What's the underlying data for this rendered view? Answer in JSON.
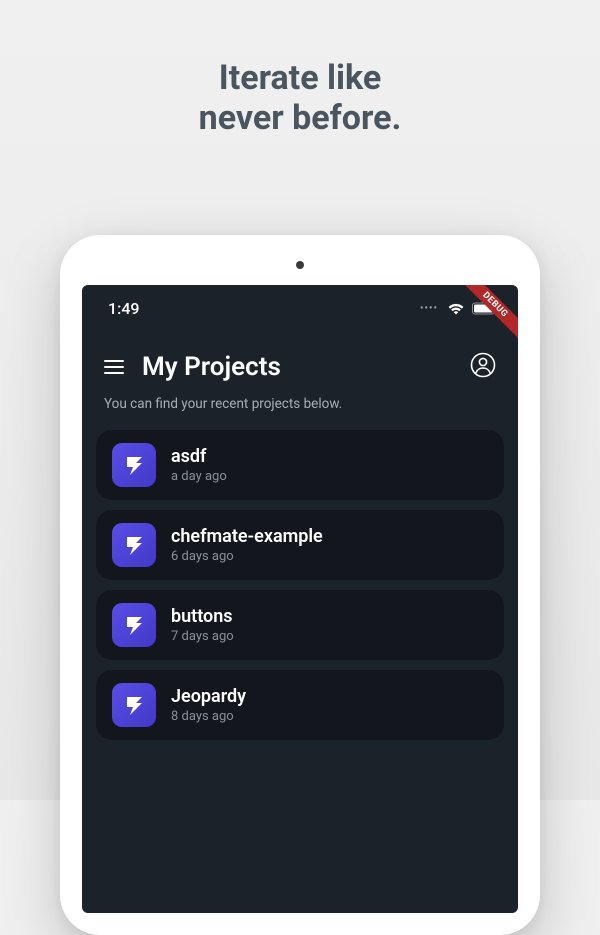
{
  "headline": {
    "line1": "Iterate like",
    "line2": "never before."
  },
  "debugBanner": "DEBUG",
  "statusBar": {
    "time": "1:49"
  },
  "header": {
    "title": "My Projects"
  },
  "subheading": "You can find your recent projects below.",
  "projects": [
    {
      "name": "asdf",
      "time": "a day ago"
    },
    {
      "name": "chefmate-example",
      "time": "6 days ago"
    },
    {
      "name": "buttons",
      "time": "7 days ago"
    },
    {
      "name": "Jeopardy",
      "time": "8 days ago"
    }
  ]
}
